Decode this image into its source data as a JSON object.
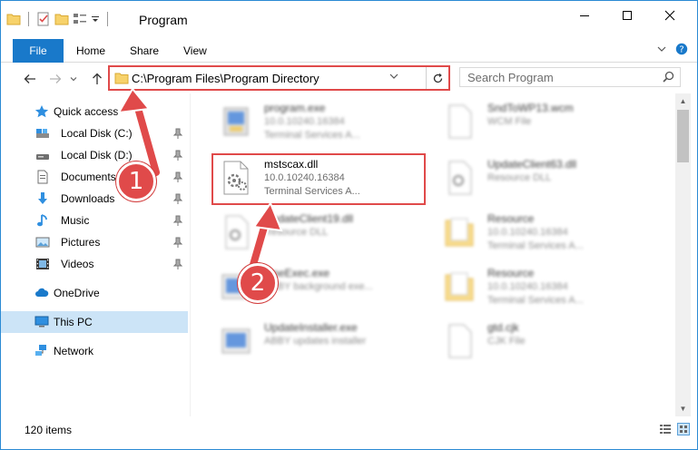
{
  "window": {
    "title": "Program",
    "controls": {
      "minimize": "—",
      "maximize": "☐",
      "close": "✕"
    }
  },
  "ribbon": {
    "tabs": [
      "File",
      "Home",
      "Share",
      "View"
    ]
  },
  "navigation": {
    "address_path": "C:\\Program Files\\Program Directory",
    "search_placeholder": "Search Program"
  },
  "sidebar": {
    "items": [
      {
        "label": "Quick access",
        "icon": "star-icon",
        "pinned": false
      },
      {
        "label": "Local Disk (C:)",
        "icon": "drive-icon",
        "pinned": true
      },
      {
        "label": "Local Disk (D:)",
        "icon": "drive-icon",
        "pinned": true
      },
      {
        "label": "Documents",
        "icon": "documents-icon",
        "pinned": true
      },
      {
        "label": "Downloads",
        "icon": "downloads-icon",
        "pinned": true
      },
      {
        "label": "Music",
        "icon": "music-icon",
        "pinned": true
      },
      {
        "label": "Pictures",
        "icon": "pictures-icon",
        "pinned": true
      },
      {
        "label": "Videos",
        "icon": "videos-icon",
        "pinned": true
      },
      {
        "label": "OneDrive",
        "icon": "cloud-icon",
        "pinned": false
      },
      {
        "label": "This PC",
        "icon": "computer-icon",
        "pinned": false,
        "selected": true
      },
      {
        "label": "Network",
        "icon": "network-icon",
        "pinned": false
      }
    ]
  },
  "files": [
    {
      "name": "program.exe",
      "meta1": "10.0.10240.16384",
      "meta2": "Terminal Services A...",
      "icon": "exe-icon",
      "blurred": true
    },
    {
      "name": "SndToWP13.wcm",
      "meta1": "WCM File",
      "meta2": "",
      "icon": "blank-file-icon",
      "blurred": true
    },
    {
      "name": "mstscax.dll",
      "meta1": "10.0.10240.16384",
      "meta2": "Terminal Services A...",
      "icon": "dll-icon",
      "blurred": false
    },
    {
      "name": "UpdateClient63.dll",
      "meta1": "Resource DLL",
      "meta2": "",
      "icon": "dll-icon",
      "blurred": true
    },
    {
      "name": "UpdateClient19.dll",
      "meta1": "Resource DLL",
      "meta2": "",
      "icon": "dll-icon",
      "blurred": true
    },
    {
      "name": "Resource",
      "meta1": "10.0.10240.16384",
      "meta2": "Terminal Services A...",
      "icon": "folder-icon",
      "blurred": true
    },
    {
      "name": "OneExec.exe",
      "meta1": "ABBY background exe...",
      "meta2": "",
      "icon": "exe-icon",
      "blurred": true
    },
    {
      "name": "Resource",
      "meta1": "10.0.10240.16384",
      "meta2": "Terminal Services A...",
      "icon": "folder-icon",
      "blurred": true
    },
    {
      "name": "UpdateInstaller.exe",
      "meta1": "ABBY updates installer",
      "meta2": "",
      "icon": "exe-icon",
      "blurred": true
    },
    {
      "name": "gtd.cjk",
      "meta1": "CJK File",
      "meta2": "",
      "icon": "blank-file-icon",
      "blurred": true
    }
  ],
  "status": {
    "item_count": "120 items"
  },
  "annotations": {
    "badge1": "1",
    "badge2": "2"
  },
  "colors": {
    "accent": "#1979ca",
    "annotation_red": "#e04a4a",
    "selection": "#cce4f7"
  }
}
